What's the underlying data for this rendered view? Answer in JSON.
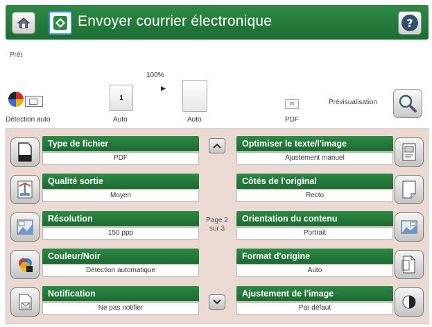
{
  "header": {
    "title": "Envoyer courrier électronique",
    "home_icon": "home-icon",
    "app_icon": "email-send-icon",
    "help_icon": "help-icon",
    "colors": {
      "bar": "#237a3a",
      "text": "#ffffff"
    }
  },
  "status": {
    "text": "Prêt",
    "zoom": "100%",
    "color_detect_label": "Détection auto",
    "copies_value": "1",
    "copies_label": "Auto",
    "size_label": "Auto",
    "file_format_label": "PDF",
    "preview_label": "Prévisualisation"
  },
  "settings": {
    "left": [
      {
        "title": "Type de fichier",
        "value": "PDF",
        "icon": "file-type-icon"
      },
      {
        "title": "Qualité sortie",
        "value": "Moyen",
        "icon": "output-quality-icon"
      },
      {
        "title": "Résolution",
        "value": "150 ppp",
        "icon": "resolution-icon"
      },
      {
        "title": "Couleur/Noir",
        "value": "Détection automatique",
        "icon": "color-black-icon"
      },
      {
        "title": "Notification",
        "value": "Ne pas notifier",
        "icon": "notification-icon"
      }
    ],
    "right": [
      {
        "title": "Optimiser le texte/l'image",
        "value": "Ajustement manuel",
        "icon": "optimize-text-image-icon"
      },
      {
        "title": "Côtés de l'original",
        "value": "Recto",
        "icon": "original-sides-icon"
      },
      {
        "title": "Orientation du contenu",
        "value": "Portrait",
        "icon": "content-orientation-icon"
      },
      {
        "title": "Format d'origine",
        "value": "Auto",
        "icon": "original-size-icon"
      },
      {
        "title": "Ajustement de l'image",
        "value": "Par défaut",
        "icon": "image-adjustment-icon"
      }
    ]
  },
  "pagination": {
    "page_line1": "Page 2",
    "page_line2": "sur 3"
  },
  "colors": {
    "panel_bg": "#ebd9d3",
    "accent_green": "#237a3a"
  }
}
